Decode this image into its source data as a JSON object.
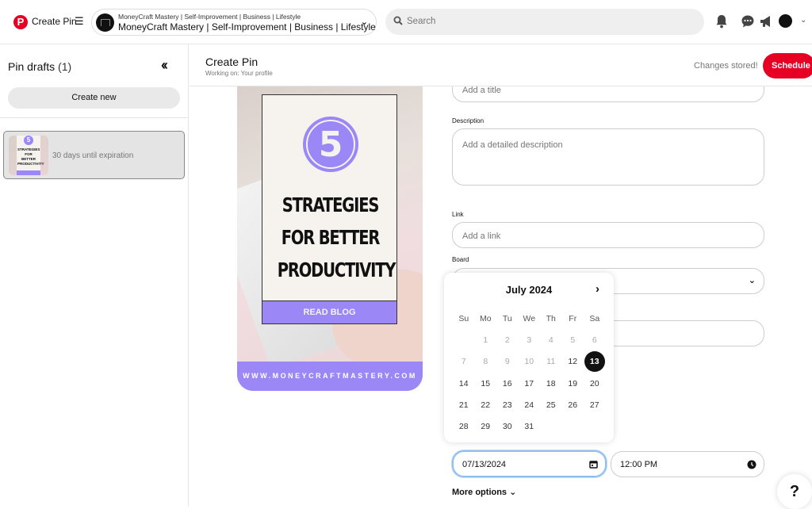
{
  "topbar": {
    "app_title": "Create Pin",
    "account": {
      "small": "MoneyCraft Mastery | Self-Improvement | Business | Lifestyle",
      "name": "MoneyCraft Mastery | Self-Improvement | Business | Lifestyle"
    },
    "search_placeholder": "Search",
    "icons": [
      "notifications-icon",
      "messages-icon",
      "announcements-icon",
      "avatar",
      "chevron-down-icon"
    ]
  },
  "sidebar": {
    "title": "Pin drafts",
    "count": "(1)",
    "create_new": "Create new",
    "drafts": [
      {
        "expiration": "30 days until expiration",
        "thumb_num": "5",
        "thumb_text": "STRATEGIES FOR BETTER PRODUCTIVITY"
      }
    ]
  },
  "header": {
    "title": "Create Pin",
    "subtitle": "Working on: Your profile",
    "status": "Changes stored!",
    "schedule": "Schedule"
  },
  "pin": {
    "number": "5",
    "headline_1": "STRATEGIES",
    "headline_2": "FOR BETTER",
    "headline_3": "PRODUCTIVITY",
    "button": "READ BLOG",
    "footer": "WWW.MONEYCRAFTMASTERY.COM"
  },
  "form": {
    "title_placeholder": "Add a title",
    "description_label": "Description",
    "description_placeholder": "Add a detailed description",
    "link_label": "Link",
    "link_placeholder": "Add a link",
    "board_label": "Board",
    "date_value": "07/13/2024",
    "time_value": "12:00 PM",
    "more_options": "More options"
  },
  "calendar": {
    "month": "July 2024",
    "weekdays": [
      "Su",
      "Mo",
      "Tu",
      "We",
      "Th",
      "Fr",
      "Sa"
    ],
    "weeks": [
      [
        "",
        "1",
        "2",
        "3",
        "4",
        "5",
        "6"
      ],
      [
        "7",
        "8",
        "9",
        "10",
        "11",
        "12",
        "13"
      ],
      [
        "14",
        "15",
        "16",
        "17",
        "18",
        "19",
        "20"
      ],
      [
        "21",
        "22",
        "23",
        "24",
        "25",
        "26",
        "27"
      ],
      [
        "28",
        "29",
        "30",
        "31",
        "",
        "",
        ""
      ]
    ],
    "disabled_through": 11,
    "selected": "13"
  },
  "help": "?",
  "colors": {
    "brand": "#e60023",
    "accent": "#9b87f5",
    "focus": "#8fbfee"
  }
}
